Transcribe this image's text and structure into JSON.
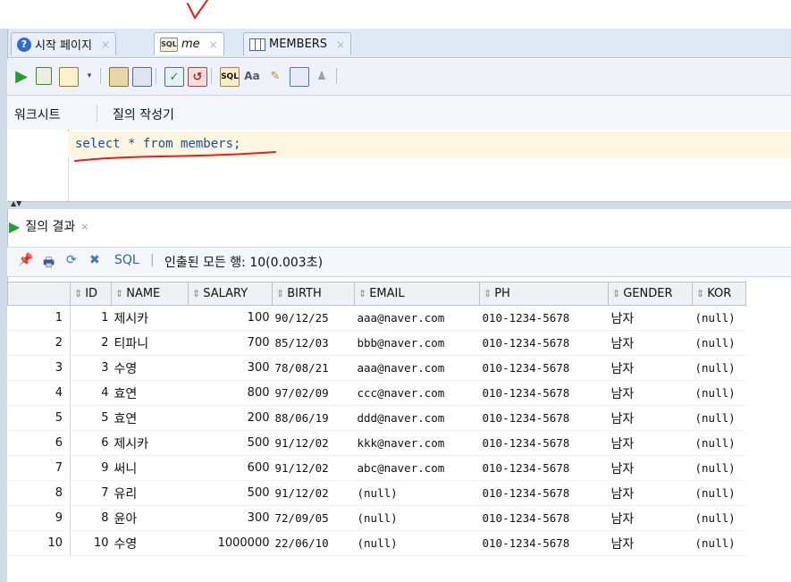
{
  "tabs": [
    {
      "label": "시작 페이지",
      "icon": "help-icon"
    },
    {
      "label": "me",
      "icon": "sql-worksheet-icon"
    },
    {
      "label": "MEMBERS",
      "icon": "table-grid-icon"
    }
  ],
  "subtabs": {
    "worksheet": "워크시트",
    "query_builder": "질의 작성기"
  },
  "editor": {
    "sql": "select * from members;"
  },
  "result": {
    "tab_label": "질의 결과",
    "sql_label": "SQL",
    "status": "인출된 모든 행: 10(0.003초)"
  },
  "grid": {
    "columns": [
      "ID",
      "NAME",
      "SALARY",
      "BIRTH",
      "EMAIL",
      "PH",
      "GENDER",
      "KOR"
    ],
    "rows": [
      [
        "1",
        "1",
        "제시카",
        "100",
        "90/12/25",
        "aaa@naver.com",
        "010-1234-5678",
        "남자",
        "(null)"
      ],
      [
        "2",
        "2",
        "티파니",
        "700",
        "85/12/03",
        "bbb@naver.com",
        "010-1234-5678",
        "남자",
        "(null)"
      ],
      [
        "3",
        "3",
        "수영",
        "300",
        "78/08/21",
        "aaa@naver.com",
        "010-1234-5678",
        "남자",
        "(null)"
      ],
      [
        "4",
        "4",
        "효연",
        "800",
        "97/02/09",
        "ccc@naver.com",
        "010-1234-5678",
        "남자",
        "(null)"
      ],
      [
        "5",
        "5",
        "효연",
        "200",
        "88/06/19",
        "ddd@naver.com",
        "010-1234-5678",
        "남자",
        "(null)"
      ],
      [
        "6",
        "6",
        "제시카",
        "500",
        "91/12/02",
        "kkk@naver.com",
        "010-1234-5678",
        "남자",
        "(null)"
      ],
      [
        "7",
        "9",
        "써니",
        "600",
        "91/12/02",
        "abc@naver.com",
        "010-1234-5678",
        "남자",
        "(null)"
      ],
      [
        "8",
        "7",
        "유리",
        "500",
        "91/12/02",
        "(null)",
        "010-1234-5678",
        "남자",
        "(null)"
      ],
      [
        "9",
        "8",
        "윤아",
        "300",
        "72/09/05",
        "(null)",
        "010-1234-5678",
        "남자",
        "(null)"
      ],
      [
        "10",
        "10",
        "수영",
        "1000000",
        "22/06/10",
        "(null)",
        "010-1234-5678",
        "남자",
        "(null)"
      ]
    ]
  },
  "colors": {
    "annotation_red": "#e02020",
    "run_green": "#1f9e31",
    "sql_blue": "#1a4ca8"
  }
}
